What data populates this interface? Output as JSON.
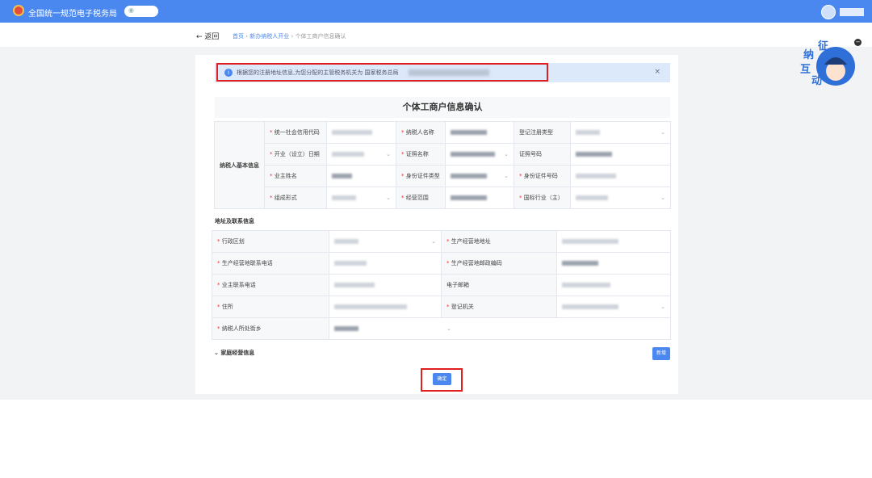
{
  "header": {
    "app_title": "全国统一规范电子税务局",
    "location_icon": "location-pin-icon"
  },
  "nav": {
    "back_label": "← 返回",
    "breadcrumb": [
      "首页",
      "新办纳税人开业",
      "个体工商户信息确认"
    ],
    "separator": "›"
  },
  "notice": {
    "text": "根据您的注册地址信息,为您分配的主管税务机关为 国家税务总局",
    "close": "×"
  },
  "form": {
    "title": "个体工商户信息确认",
    "basic": {
      "group_label": "纳税人基本信息",
      "fields": [
        {
          "label": "统一社会信用代码",
          "required": true
        },
        {
          "label": "纳税人名称",
          "required": true
        },
        {
          "label": "登记注册类型",
          "required": false,
          "select": true
        },
        {
          "label": "开业（设立）日期",
          "required": true,
          "select": true
        },
        {
          "label": "证照名称",
          "required": true,
          "select": true
        },
        {
          "label": "证照号码",
          "required": false
        },
        {
          "label": "业主姓名",
          "required": true
        },
        {
          "label": "身份证件类型",
          "required": true,
          "select": true
        },
        {
          "label": "身份证件号码",
          "required": true
        },
        {
          "label": "组成形式",
          "required": true,
          "select": true
        },
        {
          "label": "经营范围",
          "required": true
        },
        {
          "label": "国标行业（主）",
          "required": true,
          "select": true
        }
      ]
    },
    "address": {
      "section_title": "地址及联系信息",
      "fields": [
        {
          "label": "行政区划",
          "required": true,
          "select": true
        },
        {
          "label": "生产经营地地址",
          "required": true
        },
        {
          "label": "生产经营地联系电话",
          "required": true
        },
        {
          "label": "生产经营地邮政编码",
          "required": true
        },
        {
          "label": "业主联系电话",
          "required": true
        },
        {
          "label": "电子邮箱",
          "required": false
        },
        {
          "label": "住所",
          "required": true
        },
        {
          "label": "登记机关",
          "required": true,
          "select": true
        },
        {
          "label": "纳税人所处街乡",
          "required": true,
          "select": true
        }
      ]
    },
    "family": {
      "label": "家庭经营信息",
      "add_button": "新增"
    },
    "confirm_button": "确定"
  },
  "mascot": {
    "text": [
      "征",
      "纳",
      "互",
      "动"
    ]
  },
  "colors": {
    "primary": "#4a88f0",
    "highlight": "#e02020"
  }
}
